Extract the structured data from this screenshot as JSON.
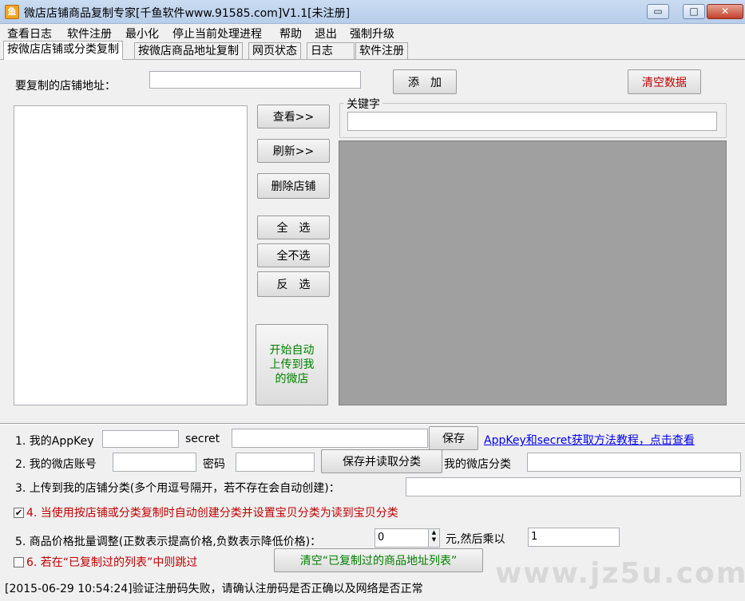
{
  "window": {
    "title": "微店店铺商品复制专家[千鱼软件www.91585.com]V1.1[未注册]",
    "icon_label": "鱼",
    "controls": {
      "minimize": "▭",
      "maximize": "□",
      "close": "✕"
    }
  },
  "menu": [
    "查看日志",
    "软件注册",
    "最小化",
    "停止当前处理进程",
    "帮助",
    "退出",
    "强制升级"
  ],
  "tabs": [
    "按微店店铺或分类复制",
    "按微店商品地址复制",
    "网页状态",
    "日志",
    "软件注册"
  ],
  "copy_tab": {
    "shop_url_label": "要复制的店铺地址：",
    "shop_url_value": "",
    "add_button": "添　加",
    "clear_data_button": "清空数据",
    "keyword_group_label": "关键字",
    "keyword_value": "",
    "view_button": "查看>>",
    "refresh_button": "刷新>>",
    "delete_shop_button": "删除店铺",
    "select_all_button": "全　选",
    "select_none_button": "全不选",
    "invert_button": "反　选",
    "start_upload_button": "开始自动\n上传到我\n的微店"
  },
  "settings": {
    "appkey_label": "1. 我的AppKey",
    "appkey_value": "",
    "secret_label": "secret",
    "secret_value": "",
    "save_button": "保存",
    "tutorial_link": "AppKey和secret获取方法教程，点击查看",
    "account_label": "2. 我的微店账号",
    "account_value": "",
    "password_label": "密码",
    "password_value": "",
    "save_read_button": "保存并读取分类",
    "my_category_label": "我的微店分类",
    "my_category_value": "",
    "upload_category_label": "3. 上传到我的店铺分类(多个用逗号隔开，若不存在会自动创建)：",
    "upload_category_value": "",
    "option4_checked": true,
    "option4_label": "4. 当使用按店铺或分类复制时自动创建分类并设置宝贝分类为读到宝贝分类",
    "price_label": "5. 商品价格批量调整(正数表示提高价格,负数表示降低价格)：",
    "price_value": "0",
    "multiply_label": "元,然后乘以",
    "multiply_value": "1",
    "option6_checked": false,
    "option6_label": "6. 若在“已复制过的列表”中则跳过",
    "clear_copied_button": "清空“已复制过的商品地址列表”"
  },
  "status_text": "[2015-06-29 10:54:24]验证注册码失败，请确认注册码是否正确以及网络是否正常",
  "watermark": "www.jz5u.com"
}
